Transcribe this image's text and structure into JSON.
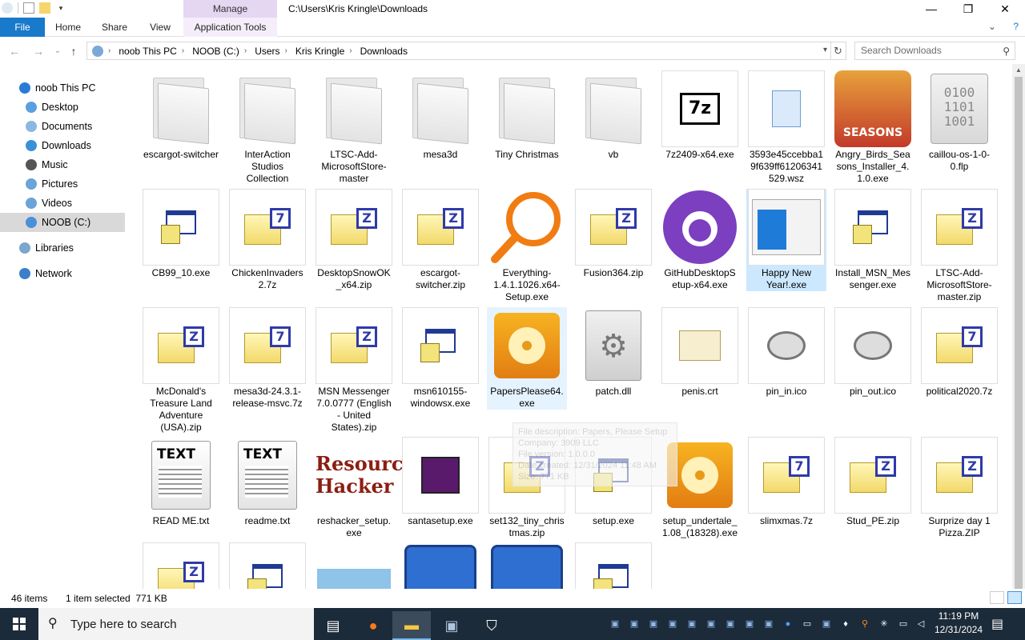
{
  "window": {
    "title": "C:\\Users\\Kris Kringle\\Downloads",
    "context_tab": "Manage",
    "controls": {
      "minimize": "—",
      "maximize": "❐",
      "close": "✕"
    }
  },
  "ribbon": {
    "tabs": [
      "File",
      "Home",
      "Share",
      "View",
      "Application Tools"
    ],
    "expand": "⌄",
    "help": "?"
  },
  "address": {
    "crumbs": [
      "noob This PC",
      "NOOB (C:)",
      "Users",
      "Kris Kringle",
      "Downloads"
    ],
    "search_placeholder": "Search Downloads"
  },
  "nav": {
    "items": [
      {
        "label": "noob This PC",
        "icon": "this-pc-icon",
        "color": "#2b7bd6"
      },
      {
        "label": "Desktop",
        "icon": "desktop-icon",
        "color": "#5aa0e0"
      },
      {
        "label": "Documents",
        "icon": "documents-icon",
        "color": "#8ab8e0"
      },
      {
        "label": "Downloads",
        "icon": "downloads-icon",
        "color": "#3a8fd9"
      },
      {
        "label": "Music",
        "icon": "music-icon",
        "color": "#555555"
      },
      {
        "label": "Pictures",
        "icon": "pictures-icon",
        "color": "#6aa4d8"
      },
      {
        "label": "Videos",
        "icon": "videos-icon",
        "color": "#6aa4d8"
      },
      {
        "label": "NOOB (C:)",
        "icon": "drive-icon",
        "color": "#4a90d9"
      },
      {
        "label": "Libraries",
        "icon": "libraries-icon",
        "color": "#7aa7cf"
      },
      {
        "label": "Network",
        "icon": "network-icon",
        "color": "#3a7fc9"
      }
    ]
  },
  "files": [
    {
      "name": "escargot-switcher",
      "type": "folder"
    },
    {
      "name": "InterAction Studios Collection",
      "type": "folder"
    },
    {
      "name": "LTSC-Add-MicrosoftStore-master",
      "type": "folder"
    },
    {
      "name": "mesa3d",
      "type": "folder"
    },
    {
      "name": "Tiny Christmas",
      "type": "folder"
    },
    {
      "name": "vb",
      "type": "folder"
    },
    {
      "name": "7z2409-x64.exe",
      "type": "7z-exe",
      "thumb": "7z"
    },
    {
      "name": "3593e45ccebba19f639ff61206341529.wsz",
      "type": "wsz"
    },
    {
      "name": "Angry_Birds_Seasons_Installer_4.1.0.exe",
      "type": "angry",
      "thumb": "SEASONS"
    },
    {
      "name": "caillou-os-1-0-0.flp",
      "type": "binary",
      "thumb": "0100 1101 1001"
    },
    {
      "name": "CB99_10.exe",
      "type": "exe"
    },
    {
      "name": "ChickenInvaders2.7z",
      "type": "zip7",
      "thumb": "7"
    },
    {
      "name": "DesktopSnowOK_x64.zip",
      "type": "zip",
      "thumb": "Z"
    },
    {
      "name": "escargot-switcher.zip",
      "type": "zip",
      "thumb": "Z"
    },
    {
      "name": "Everything-1.4.1.1026.x64-Setup.exe",
      "type": "everything"
    },
    {
      "name": "Fusion364.zip",
      "type": "zip",
      "thumb": "Z"
    },
    {
      "name": "GitHubDesktopSetup-x64.exe",
      "type": "github"
    },
    {
      "name": "Happy New Year!.exe",
      "type": "window"
    },
    {
      "name": "Install_MSN_Messenger.exe",
      "type": "exe"
    },
    {
      "name": "LTSC-Add-MicrosoftStore-master.zip",
      "type": "zip",
      "thumb": "Z"
    },
    {
      "name": "McDonald's Treasure Land Adventure (USA).zip",
      "type": "zip",
      "thumb": "Z"
    },
    {
      "name": "mesa3d-24.3.1-release-msvc.7z",
      "type": "zip7",
      "thumb": "7"
    },
    {
      "name": "MSN Messenger 7.0.0777 (English - United States).zip",
      "type": "zip",
      "thumb": "Z"
    },
    {
      "name": "msn610155-windowsx.exe",
      "type": "exe"
    },
    {
      "name": "PapersPlease64.exe",
      "type": "disc"
    },
    {
      "name": "patch.dll",
      "type": "dll"
    },
    {
      "name": "penis.crt",
      "type": "cert"
    },
    {
      "name": "pin_in.ico",
      "type": "pin"
    },
    {
      "name": "pin_out.ico",
      "type": "pin"
    },
    {
      "name": "political2020.7z",
      "type": "zip7",
      "thumb": "7"
    },
    {
      "name": "READ ME.txt",
      "type": "txt",
      "thumb": "TEXT"
    },
    {
      "name": "readme.txt",
      "type": "txt",
      "thumb": "TEXT"
    },
    {
      "name": "reshacker_setup.exe",
      "type": "reshacker",
      "thumb": "Resource Hacker"
    },
    {
      "name": "santasetup.exe",
      "type": "santa"
    },
    {
      "name": "set132_tiny_christmas.zip",
      "type": "zip",
      "thumb": "Z"
    },
    {
      "name": "setup.exe",
      "type": "exe"
    },
    {
      "name": "setup_undertale_1.08_(18328).exe",
      "type": "disc"
    },
    {
      "name": "slimxmas.7z",
      "type": "zip7",
      "thumb": "7"
    },
    {
      "name": "Stud_PE.zip",
      "type": "zip",
      "thumb": "Z"
    },
    {
      "name": "Surprize day 1 Pizza.ZIP",
      "type": "zip",
      "thumb": "Z"
    },
    {
      "name": "",
      "type": "zip",
      "thumb": "Z"
    },
    {
      "name": "",
      "type": "exe"
    },
    {
      "name": "",
      "type": "santa-card"
    },
    {
      "name": "",
      "type": "paint"
    },
    {
      "name": "",
      "type": "paint"
    },
    {
      "name": "",
      "type": "msn"
    }
  ],
  "tooltip": {
    "lines": [
      "File description: Papers, Please Setup",
      "Company: 3909 LLC",
      "File version: 1.0.0.0",
      "Date created: 12/31/2024 11:48 AM",
      "Size: 771 KB"
    ]
  },
  "status": {
    "items_count": "46 items",
    "selection": "1 item selected  771 KB"
  },
  "taskbar": {
    "search_placeholder": "Type here to search",
    "time": "11:19 PM",
    "date": "12/31/2024"
  },
  "colors": {
    "accent": "#1979ca",
    "selection": "#cce8ff",
    "taskbar": "#1c2b3a",
    "manage_tab": "#e5d6f2"
  }
}
